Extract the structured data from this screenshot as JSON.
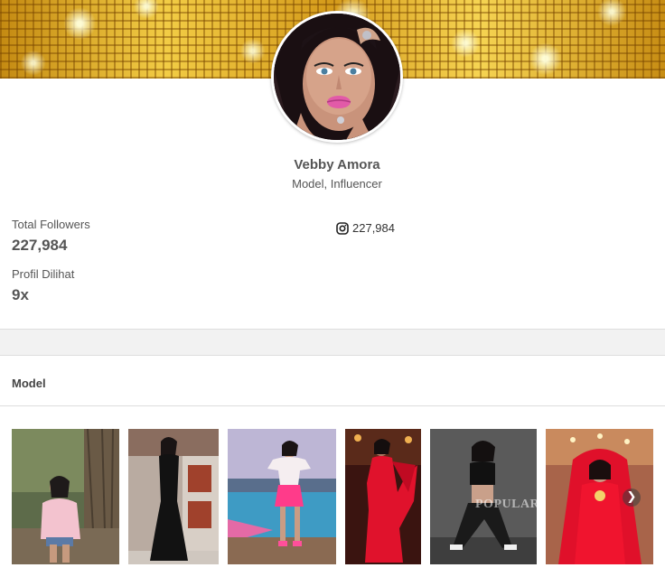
{
  "profile": {
    "name": "Vebby Amora",
    "role": "Model, Influencer"
  },
  "stats": {
    "followers_label": "Total Followers",
    "followers_value": "227,984",
    "views_label": "Profil Dilihat",
    "views_value": "9x"
  },
  "social": {
    "instagram_icon": "instagram-icon",
    "instagram_count": "227,984"
  },
  "section": {
    "title": "Model"
  },
  "gallery": {
    "watermark": "POPULAR",
    "next_icon": "chevron-right-icon",
    "photos": [
      {
        "subject": "model-photo-pink-sweater"
      },
      {
        "subject": "model-photo-black-gown"
      },
      {
        "subject": "model-photo-pink-outfit-pool"
      },
      {
        "subject": "model-photo-red-saree"
      },
      {
        "subject": "model-photo-black-outfit"
      },
      {
        "subject": "model-photo-red-bridal"
      }
    ]
  },
  "colors": {
    "text": "#555555",
    "divider": "#dddddd",
    "band": "#f2f2f2",
    "cover_gold": "#d4a017"
  }
}
